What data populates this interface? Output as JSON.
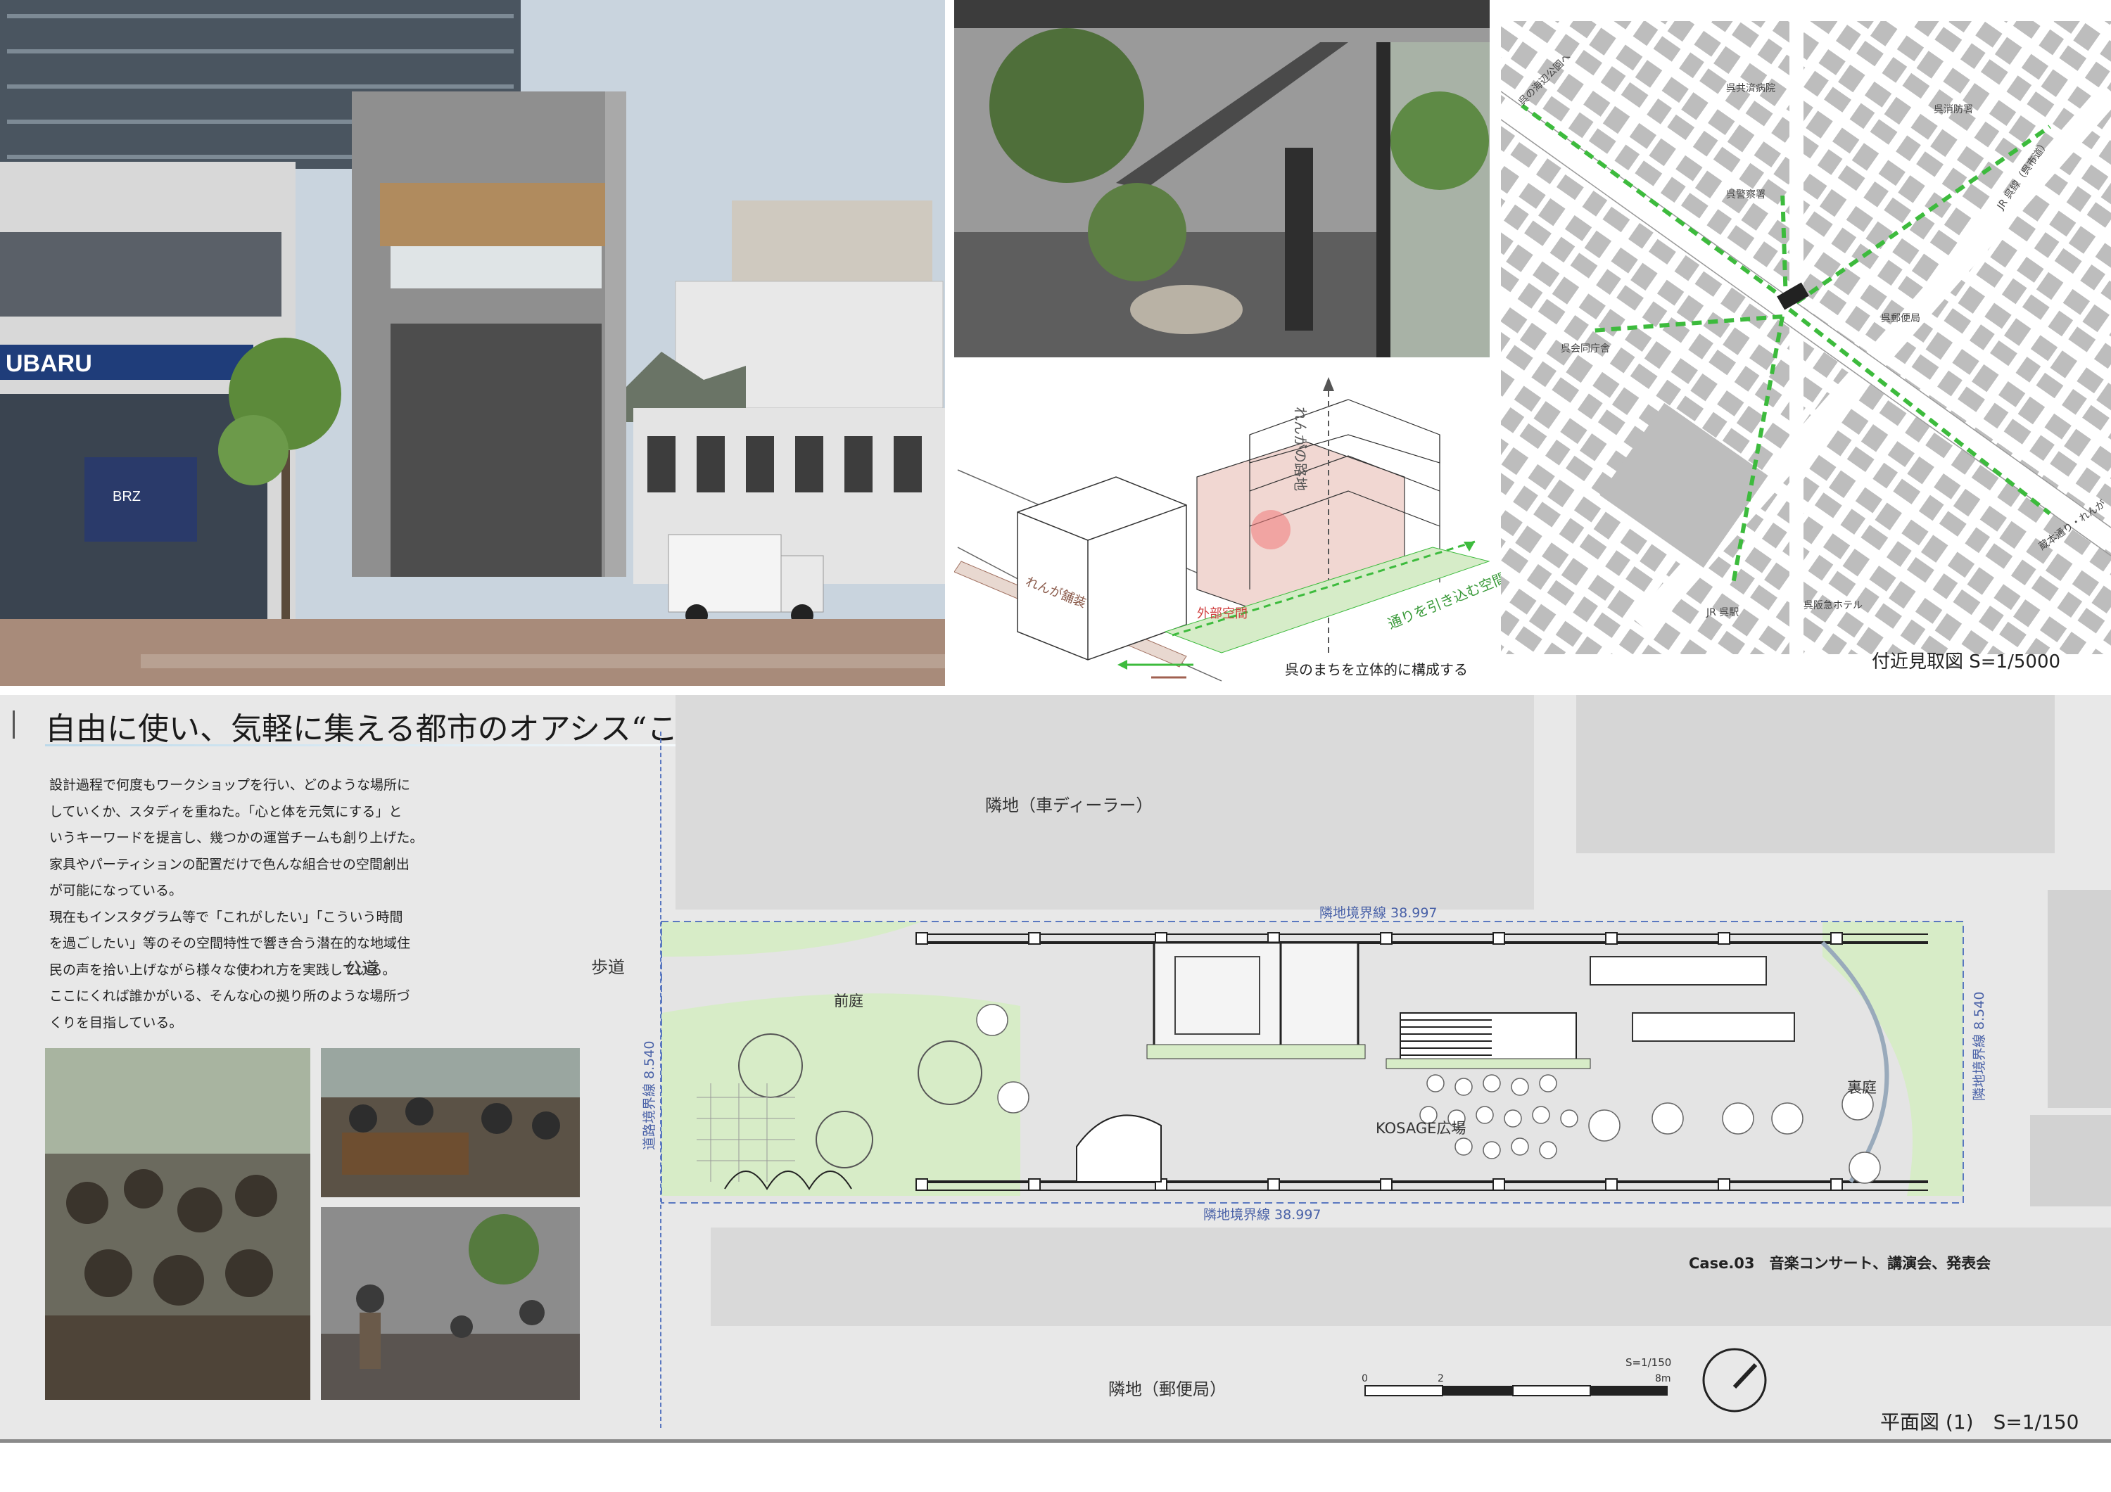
{
  "title": "自由に使い、気軽に集える都市のオアシス“こかげ広場”",
  "description_lines": [
    "設計過程で何度もワークショップを行い、どのような場所に",
    "していくか、スタディを重ねた。「心と体を元気にする」と",
    "いうキーワードを提言し、幾つかの運営チームも創り上げた。",
    "家具やパーティションの配置だけで色んな組合せの空間創出",
    "が可能になっている。",
    "現在もインスタグラム等で「これがしたい」「こういう時間",
    "を過ごしたい」等のその空間特性で響き合う潜在的な地域住",
    "民の声を拾い上げながら様々な使われ方を実践している。",
    "ここにくれば誰かがいる、そんな心の拠り所のような場所づ",
    "くりを目指している。"
  ],
  "photo": {
    "shop_sign": "UBARU",
    "car_model": "BRZ"
  },
  "diagram": {
    "caption": "呉のまちを立体的に構成する",
    "arrow_vertical": "れんがの路地",
    "arrow_road": "通りを引き込む空間",
    "external_space": "外部空間",
    "paving": "れんが舗装"
  },
  "map": {
    "caption": "付近見取図 S=1/5000",
    "labels": {
      "hospital": "呉共済病院",
      "fire": "呉消防署",
      "police": "呉警察署",
      "post": "呉郵便局",
      "hall": "呉会同庁舎",
      "station": "JR 呉駅",
      "hotel": "呉阪急ホテル",
      "road_ne": "JR 呉線（呉市道）",
      "road_nw": "呉の海辺公園へ",
      "road_se": "蔵本通り・れんが"
    }
  },
  "plan": {
    "caption": "平面図 (1)　S=1/150",
    "neighbor_top": "隣地（車ディーラー）",
    "neighbor_bottom": "隣地（郵便局）",
    "sidewalk": "歩道",
    "public_road": "公道",
    "front_garden": "前庭",
    "back_garden": "裏庭",
    "plaza": "KOSAGE広場",
    "boundary_top": "隣地境界線 38.997",
    "boundary_bottom": "隣地境界線 38.997",
    "boundary_left": "道路境界線 8.540",
    "boundary_right": "隣地境界線 8.540",
    "case_label": "Case.03　音楽コンサート、講演会、発表会",
    "scale_label": "S=1/150",
    "scale_ticks": [
      "0",
      "2",
      "8m"
    ]
  },
  "colors": {
    "green_dash": "#3dbb3d",
    "green_area": "#d7ecc7",
    "plan_bg": "#e6e6e6",
    "blue_line": "#5a78c0"
  }
}
